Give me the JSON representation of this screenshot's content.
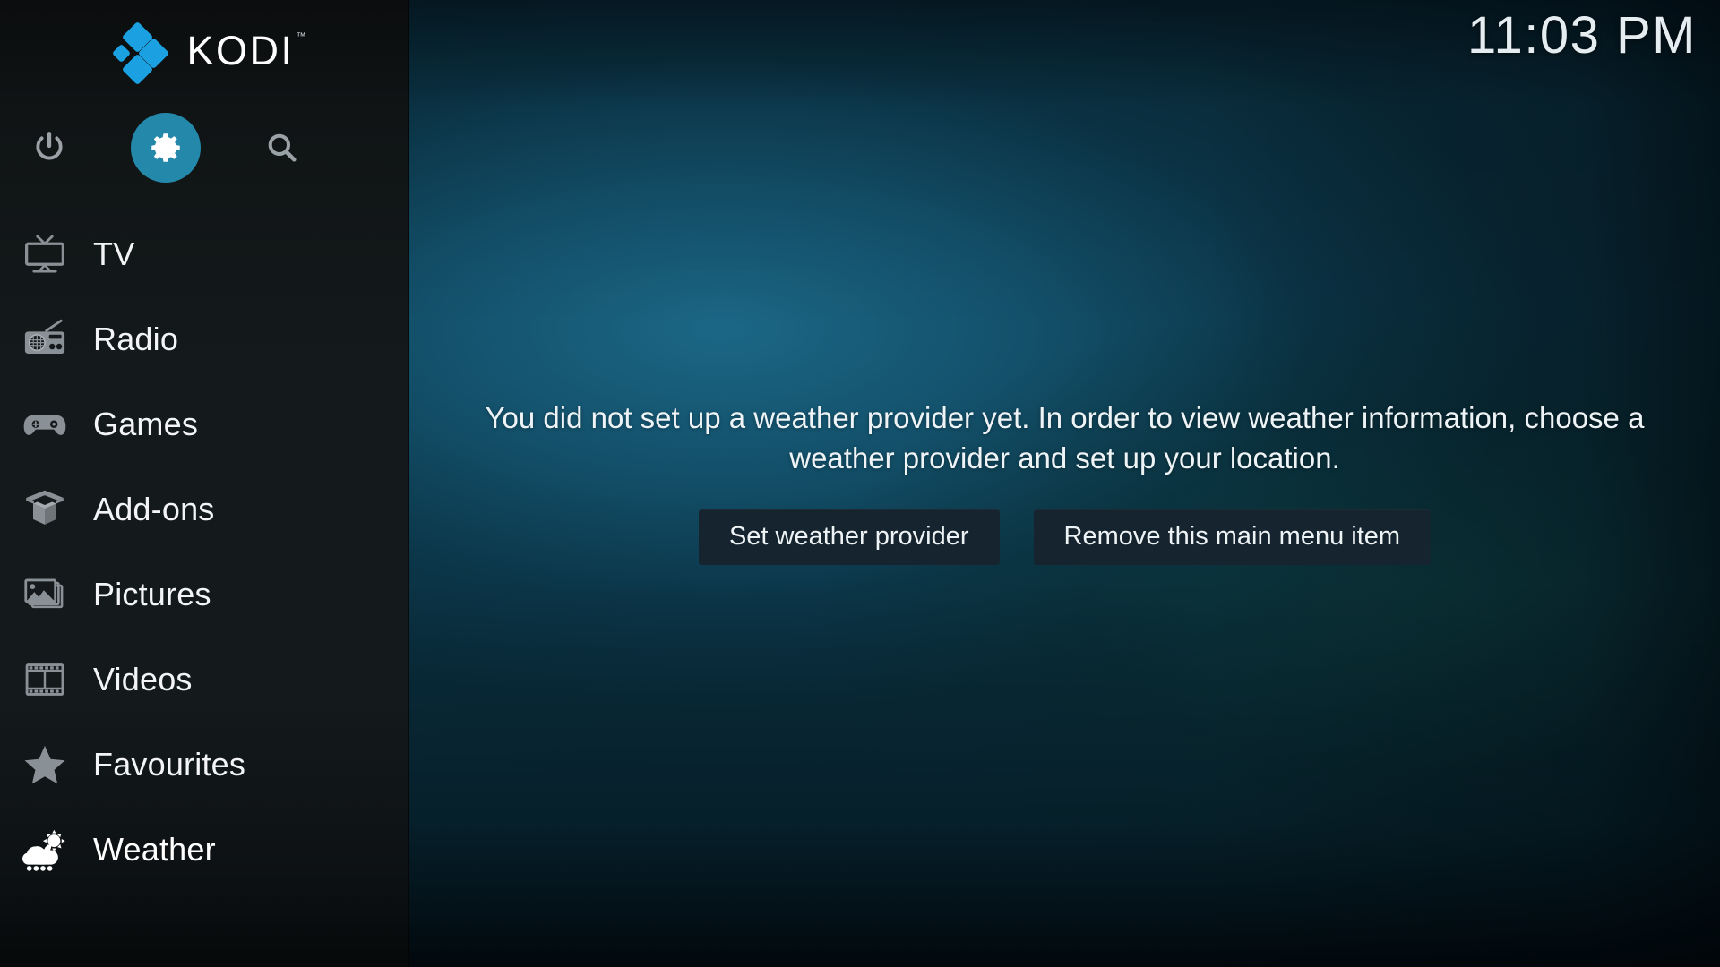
{
  "app": {
    "logo_text": "KODI",
    "logo_trademark": "™"
  },
  "clock": {
    "time": "11:03 PM"
  },
  "top_icons": [
    {
      "name": "power",
      "label": "Power",
      "active": false
    },
    {
      "name": "settings",
      "label": "Settings",
      "active": true
    },
    {
      "name": "search",
      "label": "Search",
      "active": false
    }
  ],
  "sidebar": {
    "items": [
      {
        "label": "TV",
        "icon": "tv-icon",
        "active": false
      },
      {
        "label": "Radio",
        "icon": "radio-icon",
        "active": false
      },
      {
        "label": "Games",
        "icon": "gamepad-icon",
        "active": false
      },
      {
        "label": "Add-ons",
        "icon": "open-box-icon",
        "active": false
      },
      {
        "label": "Pictures",
        "icon": "picture-icon",
        "active": false
      },
      {
        "label": "Videos",
        "icon": "film-strip-icon",
        "active": false
      },
      {
        "label": "Favourites",
        "icon": "star-icon",
        "active": false
      },
      {
        "label": "Weather",
        "icon": "weather-icon",
        "active": true
      }
    ]
  },
  "main": {
    "message": "You did not set up a weather provider yet. In order to view weather information, choose a weather provider and set up your location.",
    "buttons": [
      {
        "label": "Set weather provider"
      },
      {
        "label": "Remove this main menu item"
      }
    ]
  },
  "colors": {
    "accent_blue": "#1ba1e2",
    "gear_circle": "#2488ab",
    "sidebar_bg": "#141a1c",
    "button_bg": "#15242e",
    "background_teal": "#1c6a8a",
    "text_primary": "#eef3f6",
    "icon_inactive": "#8a9196",
    "icon_active": "#ffffff"
  }
}
